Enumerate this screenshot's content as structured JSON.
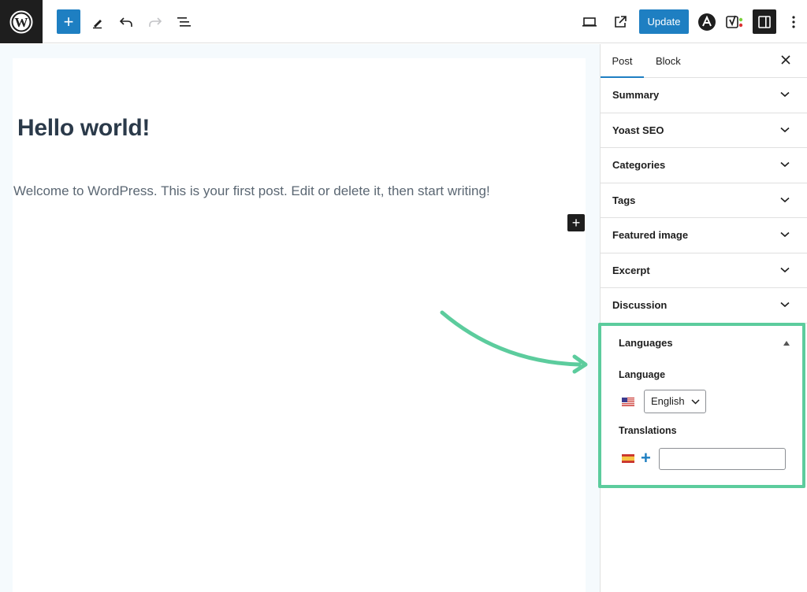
{
  "toolbar": {
    "add_label": "+",
    "update_label": "Update"
  },
  "editor": {
    "title": "Hello world!",
    "body": "Welcome to WordPress. This is your first post. Edit or delete it, then start writing!",
    "block_add_label": "+"
  },
  "sidebar": {
    "tabs": [
      {
        "label": "Post",
        "active": true
      },
      {
        "label": "Block",
        "active": false
      }
    ],
    "panels": [
      {
        "label": "Summary"
      },
      {
        "label": "Yoast SEO"
      },
      {
        "label": "Categories"
      },
      {
        "label": "Tags"
      },
      {
        "label": "Featured image"
      },
      {
        "label": "Excerpt"
      },
      {
        "label": "Discussion"
      }
    ],
    "languages": {
      "title": "Languages",
      "language_label": "Language",
      "language_value": "English",
      "translations_label": "Translations",
      "translation_add_label": "+",
      "translation_input_value": ""
    }
  },
  "colors": {
    "accent": "#1e7fc2",
    "highlight": "#5ccc9d",
    "dark": "#1e1e1e"
  },
  "icons": [
    "wordpress-logo-icon",
    "pencil-icon",
    "undo-icon",
    "redo-icon",
    "list-view-icon",
    "desktop-preview-icon",
    "external-link-icon",
    "astra-icon",
    "yoast-icon",
    "settings-sidebar-icon",
    "kebab-menu-icon",
    "close-icon",
    "chevron-down-icon",
    "flag-us-icon",
    "flag-es-icon",
    "curved-arrow-icon"
  ]
}
